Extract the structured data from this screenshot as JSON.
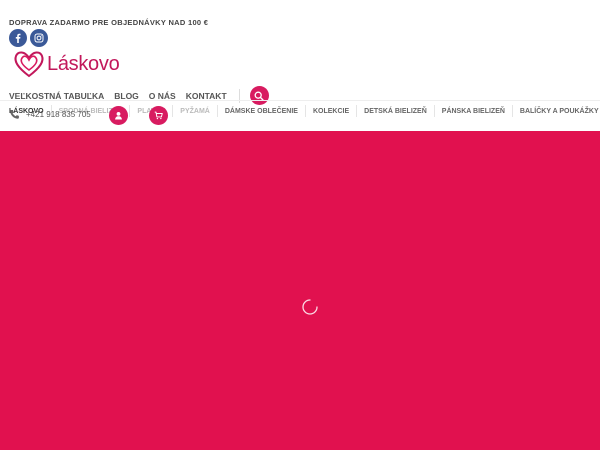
{
  "topbar": {
    "shipping_notice": "DOPRAVA ZADARMO PRE OBJEDNÁVKY NAD 100 €"
  },
  "social": [
    {
      "name": "facebook-icon"
    },
    {
      "name": "instagram-icon"
    }
  ],
  "logo": {
    "text": "Láskovo"
  },
  "mainnav": {
    "items": [
      "VEĽKOSTNÁ TABUĽKA",
      "BLOG",
      "O NÁS",
      "KONTAKT"
    ]
  },
  "catnav": {
    "items": [
      "LÁSKOVO",
      "SPODNÁ BIELIZEŇ",
      "PLAVKY",
      "PYŽAMÁ",
      "DÁMSKE OBLEČENIE",
      "KOLEKCIE",
      "DETSKÁ BIELIZEŇ",
      "PÁNSKA BIELIZEŇ",
      "BALÍČKY A POUKÁŽKY"
    ]
  },
  "contact": {
    "phone": "+421 918 835 705"
  },
  "colors": {
    "brand": "#d81b60",
    "hero": "#e1114f"
  }
}
